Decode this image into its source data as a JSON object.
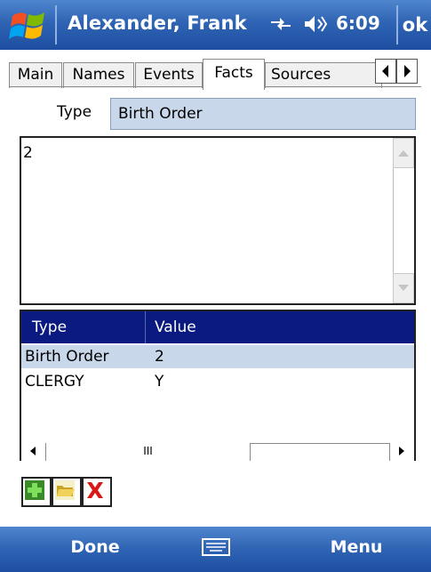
{
  "titlebar": {
    "title": "Alexander, Frank",
    "time": "6:09",
    "ok_label": "ok",
    "icons": [
      "windows-start-icon",
      "sync-icon",
      "volume-icon"
    ]
  },
  "tabs": [
    {
      "label": "Main",
      "active": false
    },
    {
      "label": "Names",
      "active": false
    },
    {
      "label": "Events",
      "active": false
    },
    {
      "label": "Facts",
      "active": true
    },
    {
      "label": "Sources",
      "active": false
    }
  ],
  "form": {
    "type_label": "Type",
    "type_value": "Birth Order",
    "value_text": "2"
  },
  "facts_list": {
    "columns": [
      "Type",
      "Value"
    ],
    "rows": [
      {
        "type": "Birth Order",
        "value": "2",
        "selected": true
      },
      {
        "type": "CLERGY",
        "value": "Y",
        "selected": false
      }
    ],
    "hscroll_thumb": "III"
  },
  "toolbar": {
    "buttons": [
      "add-icon",
      "open-folder-icon",
      "delete-icon"
    ]
  },
  "softkeys": {
    "left": "Done",
    "right": "Menu"
  },
  "colors": {
    "titlebar": "#2f63b3",
    "list_header": "#0a1a80",
    "selection": "#c8d8ea"
  }
}
